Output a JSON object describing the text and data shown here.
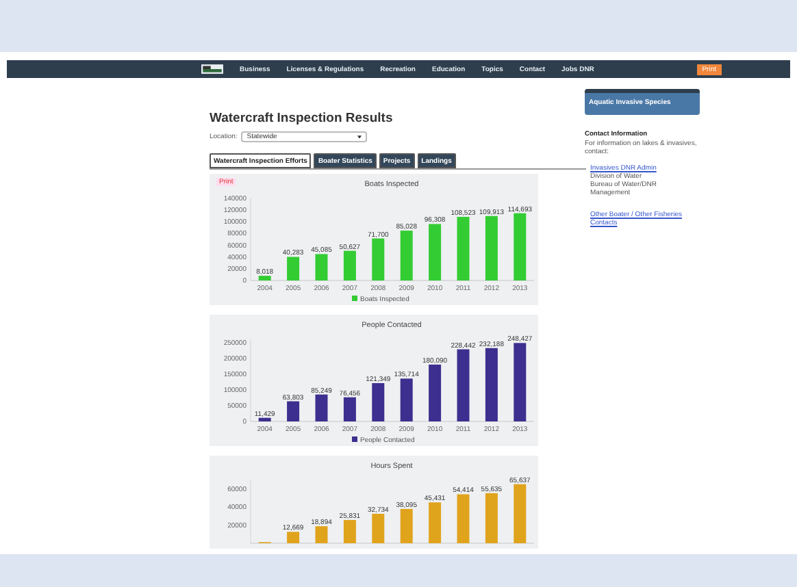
{
  "nav": {
    "items": [
      "Business",
      "Licenses & Regulations",
      "Recreation",
      "Education",
      "Topics",
      "Contact",
      "Jobs DNR"
    ],
    "button": "Print"
  },
  "title": "Watercraft Inspection Results",
  "location": {
    "label": "Location:",
    "value": "Statewide"
  },
  "tabs": [
    {
      "label": "Watercraft Inspection Efforts",
      "selected": true
    },
    {
      "label": "Boater Statistics",
      "selected": false
    },
    {
      "label": "Projects",
      "selected": false
    },
    {
      "label": "Landings",
      "selected": false
    }
  ],
  "print_link": "Print",
  "charts": [
    {
      "chart_data": {
        "type": "bar",
        "title": "Boats Inspected",
        "categories": [
          "2004",
          "2005",
          "2006",
          "2007",
          "2008",
          "2009",
          "2010",
          "2011",
          "2012",
          "2013"
        ],
        "series": [
          {
            "name": "Boats Inspected",
            "color": "#33cc33",
            "values": [
              8018,
              40283,
              45085,
              50627,
              71700,
              85028,
              96308,
              108523,
              109913,
              114693
            ]
          }
        ],
        "ylim": [
          0,
          140000
        ],
        "yticks": [
          0,
          20000,
          40000,
          60000,
          80000,
          100000,
          120000,
          140000
        ],
        "value_labels": [
          "8,018",
          "40,283",
          "45,085",
          "50,627",
          "71,700",
          "85,028",
          "96,308",
          "108,523",
          "109,913",
          "114,693"
        ]
      }
    },
    {
      "chart_data": {
        "type": "bar",
        "title": "People Contacted",
        "categories": [
          "2004",
          "2005",
          "2006",
          "2007",
          "2008",
          "2009",
          "2010",
          "2011",
          "2012",
          "2013"
        ],
        "series": [
          {
            "name": "People Contacted",
            "color": "#3d2f8f",
            "values": [
              11429,
              63803,
              85249,
              76456,
              121349,
              135714,
              180090,
              228442,
              232188,
              248427
            ]
          }
        ],
        "ylim": [
          0,
          260000
        ],
        "yticks": [
          0,
          50000,
          100000,
          150000,
          200000,
          250000
        ],
        "value_labels": [
          "11,429",
          "63,803",
          "85,249",
          "76,456",
          "121,349",
          "135,714",
          "180,090",
          "228,442",
          "232,188",
          "248,427"
        ]
      }
    },
    {
      "chart_data": {
        "type": "bar",
        "title": "Hours Spent",
        "series": [
          {
            "color": "#e0a31c",
            "values": [
              1200,
              12669,
              18894,
              25831,
              32734,
              38095,
              45431,
              54414,
              55635,
              65637
            ]
          }
        ],
        "ylim": [
          0,
          70000
        ],
        "yticks": [
          20000,
          40000,
          60000
        ],
        "value_labels": [
          null,
          "12,669",
          "18,894",
          "25,831",
          "32,734",
          "38,095",
          "45,431",
          "54,414",
          "55,635",
          "65,637"
        ]
      }
    }
  ],
  "sidebar": {
    "heading": "Aquatic Invasive Species",
    "contact_title": "Contact Information",
    "contact_text": "For information on lakes & invasives, contact:",
    "links": [
      {
        "kind": "link",
        "text": "Invasives DNR Admin"
      },
      {
        "kind": "text",
        "text": "Division of Water"
      },
      {
        "kind": "text",
        "text": "Bureau of Water/DNR"
      },
      {
        "kind": "text",
        "text": "Management"
      },
      {
        "kind": "gap"
      },
      {
        "kind": "link",
        "text": "Other Boater / Other Fisheries Contacts"
      }
    ]
  }
}
